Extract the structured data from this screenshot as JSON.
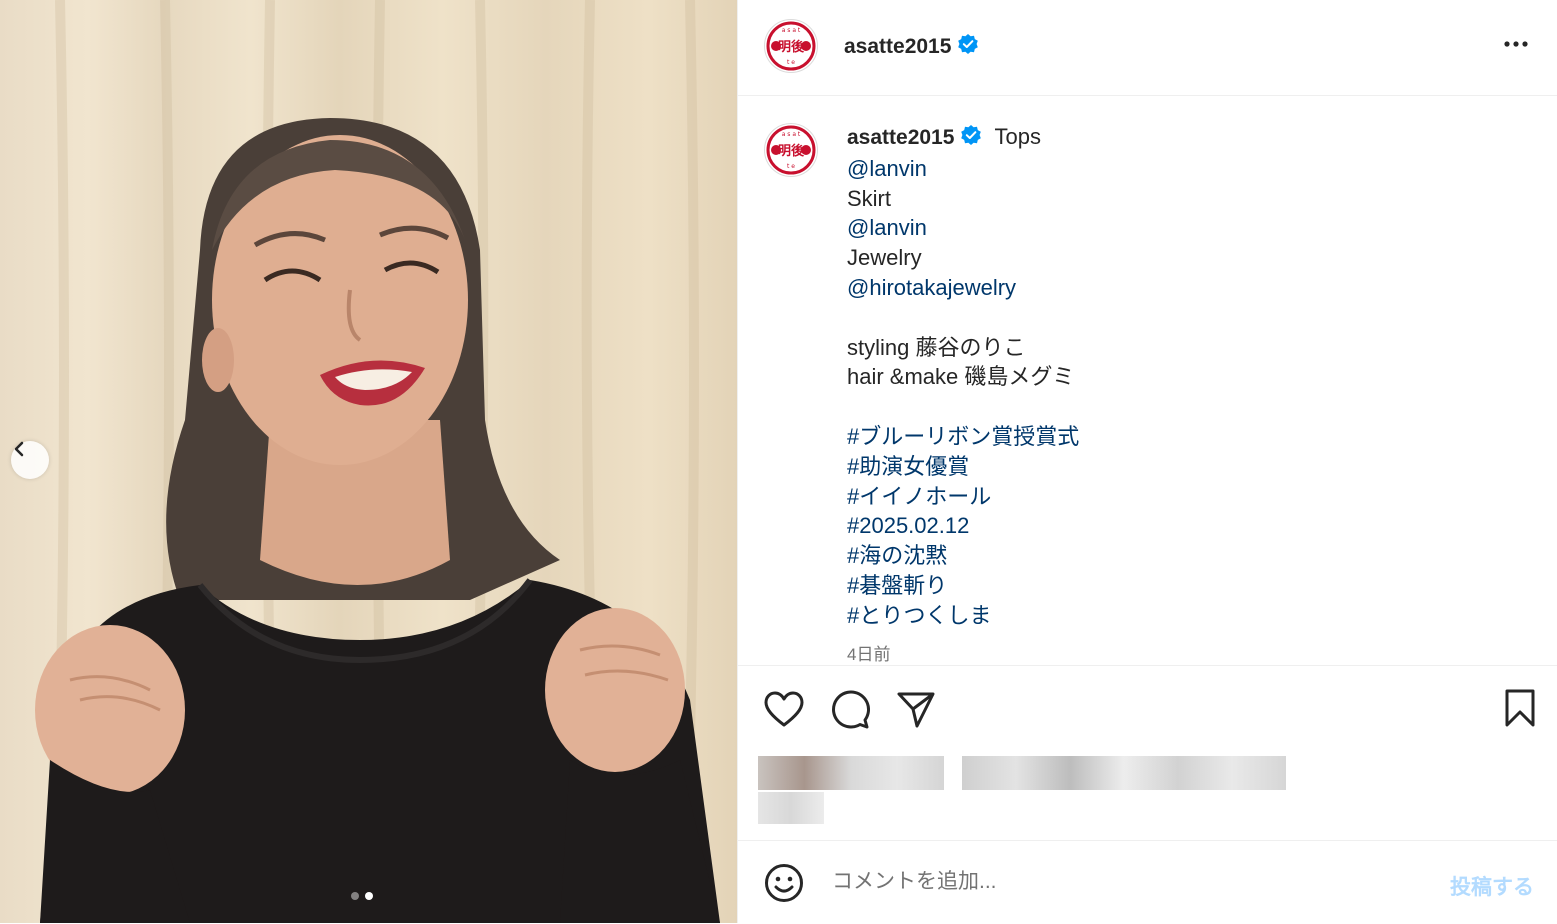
{
  "post": {
    "username": "asatte2015",
    "avatar_logo_text": "明後日"
  },
  "caption": {
    "username": "asatte2015",
    "lines": [
      {
        "text": "Tops",
        "type": "text"
      },
      {
        "text": "@lanvin",
        "type": "link"
      },
      {
        "text": "Skirt",
        "type": "text"
      },
      {
        "text": "@lanvin",
        "type": "link"
      },
      {
        "text": "Jewelry",
        "type": "text"
      },
      {
        "text": "@hirotakajewelry",
        "type": "link"
      },
      {
        "text": "",
        "type": "gap"
      },
      {
        "text": "styling 藤谷のりこ",
        "type": "text"
      },
      {
        "text": "hair &make 磯島メグミ",
        "type": "text"
      },
      {
        "text": "",
        "type": "gap"
      },
      {
        "text": "#ブルーリボン賞授賞式",
        "type": "link"
      },
      {
        "text": "#助演女優賞",
        "type": "link"
      },
      {
        "text": "#イイノホール",
        "type": "link"
      },
      {
        "text": "#2025.02.12",
        "type": "link"
      },
      {
        "text": "#海の沈黙",
        "type": "link"
      },
      {
        "text": "#碁盤斬り",
        "type": "link"
      },
      {
        "text": "#とりつくしま",
        "type": "link"
      }
    ],
    "timestamp": "4日前"
  },
  "comment": {
    "placeholder": "コメントを追加...",
    "post_label": "投稿する"
  },
  "carousel": {
    "total": 2,
    "current": 2
  },
  "icons": {
    "prev": "chevron-left-icon",
    "more": "more-options-icon",
    "like": "heart-icon",
    "comment": "comment-icon",
    "share": "send-icon",
    "save": "bookmark-icon",
    "emoji": "emoji-icon",
    "verified": "verified-badge-icon"
  },
  "colors": {
    "link": "#00376b",
    "verified": "#0095f6",
    "post_button_disabled": "#b3dbff",
    "timestamp": "#737373",
    "logo_red": "#c8102e"
  }
}
